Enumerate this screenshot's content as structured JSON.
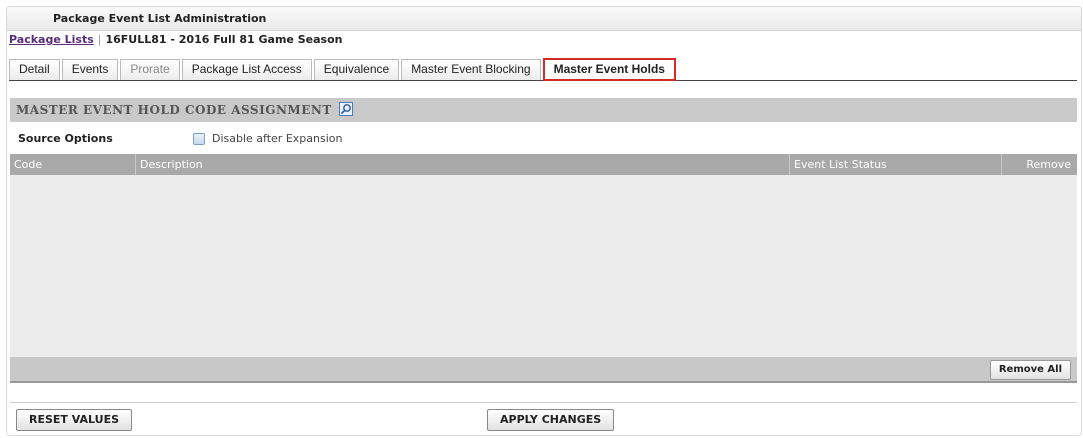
{
  "panel": {
    "title": "Package Event List Administration"
  },
  "breadcrumb": {
    "link": "Package Lists",
    "separator": "|",
    "current": "16FULL81 - 2016 Full 81 Game Season"
  },
  "tabs": [
    {
      "label": "Detail"
    },
    {
      "label": "Events"
    },
    {
      "label": "Prorate"
    },
    {
      "label": "Package List Access"
    },
    {
      "label": "Equivalence"
    },
    {
      "label": "Master Event Blocking"
    },
    {
      "label": "Master Event Holds"
    }
  ],
  "section": {
    "title": "MASTER EVENT HOLD CODE ASSIGNMENT",
    "icon": "search-icon"
  },
  "source_options": {
    "label": "Source Options",
    "checkbox_label": "Disable after Expansion",
    "checked": false
  },
  "grid": {
    "columns": [
      "Code",
      "Description",
      "Event List Status",
      "Remove"
    ],
    "rows": [],
    "remove_all_label": "Remove All"
  },
  "actions": {
    "reset_label": "RESET VALUES",
    "apply_label": "APPLY CHANGES"
  },
  "colors": {
    "active_tab_border": "#d42a2a",
    "link": "#5a2d7a",
    "grid_header": "#a9a9a9"
  }
}
